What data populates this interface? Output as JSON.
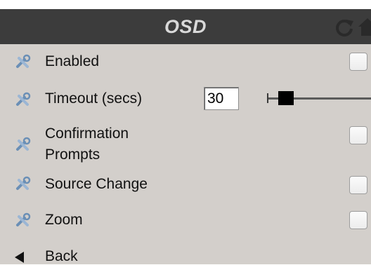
{
  "header": {
    "title": "OSD",
    "refresh_icon": "refresh-icon",
    "home_icon": "home-icon"
  },
  "settings": {
    "enabled": {
      "label": "Enabled",
      "checked": false,
      "icon": "tools-icon"
    },
    "timeout": {
      "label": "Timeout (secs)",
      "value": "30",
      "icon": "tools-icon"
    },
    "confirmation": {
      "label_line1": "Confirmation",
      "label_line2": "Prompts",
      "checked": false,
      "icon": "tools-icon"
    },
    "source_change": {
      "label": "Source Change",
      "checked": false,
      "icon": "tools-icon"
    },
    "zoom": {
      "label": "Zoom",
      "checked": false,
      "icon": "tools-icon"
    }
  },
  "nav": {
    "back_label": "Back",
    "back_icon": "back-arrow-icon"
  },
  "colors": {
    "header_bg": "#3c3c3c",
    "panel_bg": "#d3cfcb",
    "title_text": "#d9d9d9"
  }
}
